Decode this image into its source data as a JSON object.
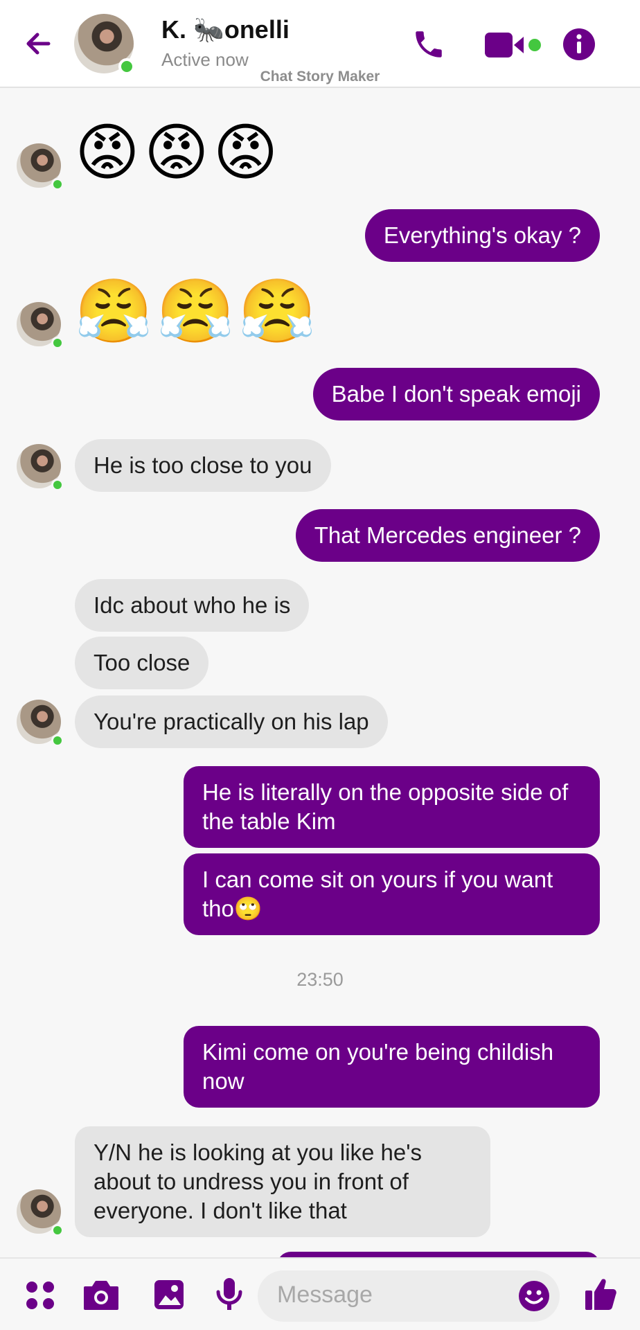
{
  "header": {
    "contact_name": "K. 🐜onelli",
    "status": "Active now",
    "watermark": "Chat Story Maker",
    "icons": [
      "back-arrow-icon",
      "phone-icon",
      "video-camera-icon",
      "info-icon"
    ]
  },
  "colors": {
    "accent": "#6b0088",
    "incoming_bubble": "#e4e4e4",
    "online": "#44c73f"
  },
  "messages": [
    {
      "from": "them",
      "type": "emoji",
      "text": "😡😡😡"
    },
    {
      "from": "me",
      "text": "Everything's okay ?"
    },
    {
      "from": "them",
      "type": "emoji",
      "text": "😤😤😤"
    },
    {
      "from": "me",
      "text": "Babe I don't speak emoji"
    },
    {
      "from": "them",
      "text": "He is too close to you"
    },
    {
      "from": "me",
      "text": "That Mercedes engineer ?"
    },
    {
      "from": "them",
      "text": "Idc about who he is"
    },
    {
      "from": "them",
      "text": "Too close"
    },
    {
      "from": "them",
      "text": "You're practically on his lap"
    },
    {
      "from": "me",
      "text": "He is literally on the opposite side of the table Kim"
    },
    {
      "from": "me",
      "text": "I can come sit on yours if you want tho🙄"
    },
    {
      "type": "timestamp",
      "text": "23:50"
    },
    {
      "from": "me",
      "text": "Kimi come on you're being childish now"
    },
    {
      "from": "them",
      "text": "Y/N he is looking at you like he's about to undress you in front of everyone. I don't like that"
    }
  ],
  "composer": {
    "placeholder": "Message",
    "icons": [
      "apps-icon",
      "camera-icon",
      "gallery-icon",
      "microphone-icon",
      "emoji-icon",
      "thumbs-up-icon"
    ]
  }
}
